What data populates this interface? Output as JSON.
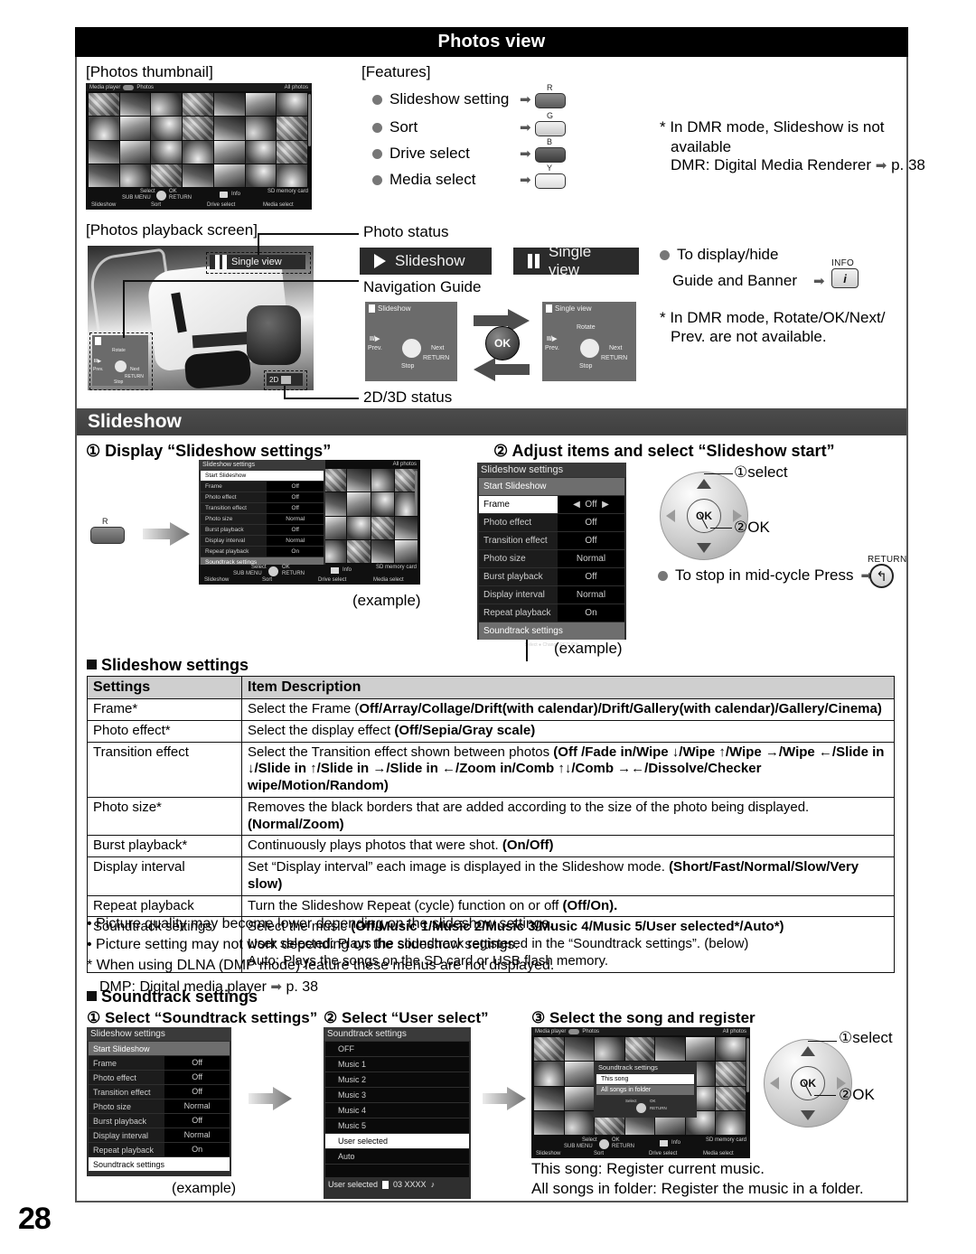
{
  "page": {
    "number": "28"
  },
  "header": {
    "title": "Photos view"
  },
  "photos_thumbnail": {
    "caption": "[Photos thumbnail]",
    "screen": {
      "top_left": "Media player",
      "top_left_2": "Photos",
      "top_right": "All photos",
      "bottom_select": "Select",
      "bottom_ok": "OK",
      "bottom_submenu": "SUB MENU",
      "bottom_return": "RETURN",
      "bottom_info": "Info",
      "bottom_media": "SD memory card",
      "keys": [
        "Slideshow",
        "Sort",
        "Drive select",
        "Media select"
      ]
    }
  },
  "features": {
    "caption": "[Features]",
    "items": [
      {
        "label": "Slideshow setting",
        "key": "R"
      },
      {
        "label": "Sort",
        "key": "G"
      },
      {
        "label": "Drive select",
        "key": "B"
      },
      {
        "label": "Media select",
        "key": "Y"
      }
    ],
    "note_line1": "* In DMR mode, Slideshow is not",
    "note_line2": "available",
    "note_line3": "DMR: Digital Media Renderer",
    "note_page": "p. 38"
  },
  "playback": {
    "caption": "[Photos playback screen]",
    "photo_status_label": "Photo status",
    "navigation_guide_label": "Navigation Guide",
    "twod_threed_label": "2D/3D status",
    "badge_single_view": "Single view",
    "badge_2d": "2D",
    "status_slideshow": "Slideshow",
    "status_single_view": "Single view",
    "guide_left_title": "Slideshow",
    "guide_right_title": "Single view",
    "guide_ok": "OK",
    "guide_labels": {
      "playpause": "II/▶",
      "prev": "Prev.",
      "next": "Next",
      "return": "RETURN",
      "stop": "Stop",
      "rotate": "Rotate"
    },
    "display_hide_line1": "To display/hide",
    "display_hide_line2": "Guide and Banner",
    "info_key_cap": "INFO",
    "info_key_glyph": "i",
    "dmr_note_1": "* In DMR mode, Rotate/OK/Next/",
    "dmr_note_2": "Prev. are not available."
  },
  "slideshow_section": {
    "band_title": "Slideshow",
    "step1": "① Display “Slideshow settings”",
    "step2": "② Adjust items and select “Slideshow start”",
    "example": "(example)",
    "r_key": "R",
    "select_label": "①select",
    "ok_label": "②OK",
    "ok_text": "OK",
    "stop_note": "To stop in mid-cycle Press",
    "return_cap": "RETURN",
    "menu": {
      "title": "Slideshow settings",
      "start": "Start Slideshow",
      "rows": [
        {
          "k": "Frame",
          "v": "Off"
        },
        {
          "k": "Photo effect",
          "v": "Off"
        },
        {
          "k": "Transition effect",
          "v": "Off"
        },
        {
          "k": "Photo size",
          "v": "Normal"
        },
        {
          "k": "Burst playback",
          "v": "Off"
        },
        {
          "k": "Display interval",
          "v": "Normal"
        },
        {
          "k": "Repeat playback",
          "v": "On"
        }
      ],
      "soundtrack": "Soundtrack settings",
      "nav_select": "Select",
      "nav_change": "Change",
      "nav_return": "RETURN"
    }
  },
  "settings_table": {
    "heading": "Slideshow settings",
    "columns": [
      "Settings",
      "Item Description"
    ],
    "rows": [
      {
        "setting": "Frame*",
        "desc_plain": "Select the Frame (",
        "desc_bold": "Off/Array/Collage/Drift(with calendar)/Drift/Gallery(with calendar)/Gallery/Cinema)"
      },
      {
        "setting": "Photo effect*",
        "desc_plain": "Select the display effect ",
        "desc_bold": "(Off/Sepia/Gray scale)"
      },
      {
        "setting": "Transition effect",
        "desc_plain": "Select the Transition effect shown between photos ",
        "desc_bold": "(Off /Fade in/Wipe ↓/Wipe ↑/Wipe →/Wipe ←/Slide in ↓/Slide in ↑/Slide in →/Slide in ←/Zoom in/Comb ↑↓/Comb →←/Dissolve/Checker wipe/Motion/Random)"
      },
      {
        "setting": "Photo size*",
        "desc_plain": "Removes the black borders that are added according to the size of the photo being displayed. ",
        "desc_bold": "(Normal/Zoom)"
      },
      {
        "setting": "Burst playback*",
        "desc_plain": "Continuously plays photos that were shot. ",
        "desc_bold": "(On/Off)"
      },
      {
        "setting": "Display interval",
        "desc_plain": "Set “Display interval” each image is displayed in the Slideshow mode. ",
        "desc_bold": "(Short/Fast/Normal/Slow/Very slow)"
      },
      {
        "setting": "Repeat playback",
        "desc_plain": "Turn the Slideshow Repeat (cycle) function on or off ",
        "desc_bold": "(Off/On)."
      },
      {
        "setting": "Soundtrack settings",
        "desc_plain": "Select the music ",
        "desc_bold": "(Off/Music 1/Music 2/Music 3/Music 4/Music 5/User selected*/Auto*)",
        "desc_line2": "User selected: Plays the soundtrack registered in the “Soundtrack settings”. (below)",
        "desc_line3": "Auto: Plays the songs on the SD card or USB flash memory."
      }
    ]
  },
  "notes": {
    "n1": "• Picture quality may become lower depending on the slideshow settings.",
    "n2": "• Picture setting may not work depending on the slideshow settings.",
    "n3": "* When using DLNA (DMP mode) feature these menus are not displayed.",
    "n4": "DMP: Digital media player",
    "n4_page": "p. 38"
  },
  "soundtrack_section": {
    "heading": "Soundtrack settings",
    "step1": "① Select “Soundtrack settings”",
    "step2": "② Select “User select”",
    "step3": "③ Select the song and register",
    "example": "(example)",
    "select_label": "①select",
    "ok_label": "②OK",
    "ok_text": "OK",
    "menu": {
      "title": "Slideshow settings",
      "start": "Start Slideshow",
      "rows": [
        {
          "k": "Frame",
          "v": "Off"
        },
        {
          "k": "Photo effect",
          "v": "Off"
        },
        {
          "k": "Transition effect",
          "v": "Off"
        },
        {
          "k": "Photo size",
          "v": "Normal"
        },
        {
          "k": "Burst playback",
          "v": "Off"
        },
        {
          "k": "Display interval",
          "v": "Normal"
        },
        {
          "k": "Repeat playback",
          "v": "On"
        }
      ],
      "soundtrack": "Soundtrack settings"
    },
    "soundtrack_list": {
      "title": "Soundtrack settings",
      "items": [
        "OFF",
        "Music 1",
        "Music 2",
        "Music 3",
        "Music 4",
        "Music 5",
        "User selected",
        "Auto"
      ],
      "selected": "User selected",
      "footer_label": "User selected",
      "footer_track": "03 XXXX"
    },
    "register_dialog": {
      "title": "Soundtrack settings",
      "option1": "This song",
      "option2": "All songs in folder",
      "nav_select": "Select",
      "nav_ok": "OK",
      "nav_return": "RETURN"
    },
    "register_screen": {
      "top_left": "Media player",
      "top_left_2": "Photos",
      "top_right": "All photos",
      "bottom_select": "Select",
      "bottom_ok": "OK",
      "bottom_submenu": "SUB MENU",
      "bottom_return": "RETURN",
      "bottom_info": "Info",
      "bottom_media": "SD memory card",
      "keys": [
        "Slideshow",
        "Sort",
        "Drive select",
        "Media select"
      ]
    },
    "desc1": "This song: Register current music.",
    "desc2": "All songs in folder: Register the music in a folder."
  },
  "colors": {
    "title_bar": "#000000",
    "band": "#4c4c4c",
    "table_header": "#cfcfcf"
  }
}
